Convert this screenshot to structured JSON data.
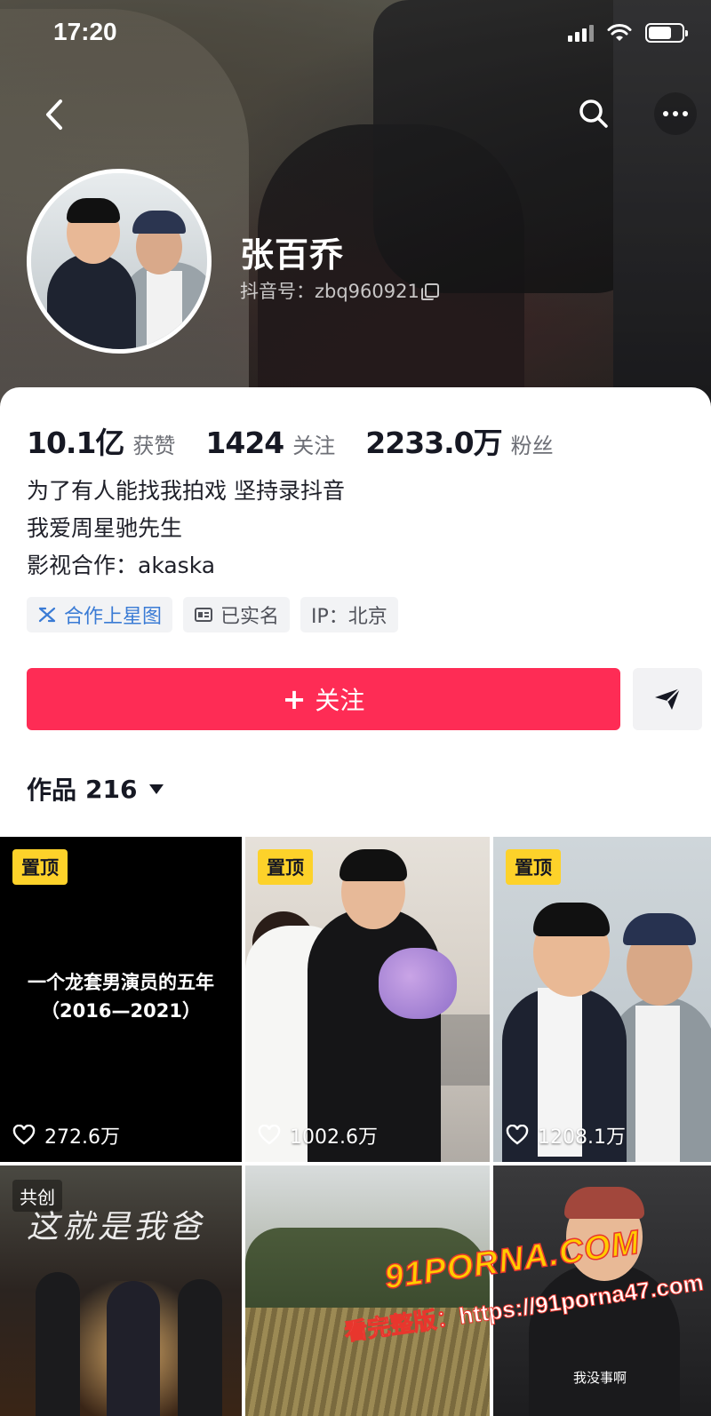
{
  "status_bar": {
    "time": "17:20"
  },
  "profile": {
    "name": "张百乔",
    "douyin_id": "抖音号：zbq960921"
  },
  "stats": [
    {
      "value": "10.1亿",
      "label": "获赞"
    },
    {
      "value": "1424",
      "label": "关注"
    },
    {
      "value": "2233.0万",
      "label": "粉丝"
    }
  ],
  "bio": [
    "为了有人能找我拍戏  坚持录抖音",
    "我爱周星驰先生",
    "影视合作：akaska"
  ],
  "tags": [
    {
      "label": "合作上星图",
      "icon": "star-map-icon",
      "color": "#3a7bd5"
    },
    {
      "label": "已实名",
      "icon": "id-card-icon"
    },
    {
      "label": "IP：北京"
    }
  ],
  "actions": {
    "follow_plus": "+",
    "follow_label": "关注",
    "accent_color": "#fe2c55"
  },
  "works": {
    "label": "作品",
    "count": "216"
  },
  "videos": [
    {
      "badge": "置顶",
      "likes": "272.6万",
      "cover_text": [
        "一个龙套男演员的五年",
        "（2016—2021）"
      ]
    },
    {
      "badge": "置顶",
      "likes": "1002.6万"
    },
    {
      "badge": "置顶",
      "likes": "1208.1万"
    },
    {
      "badge": "共创",
      "cover_title": "这就是我爸"
    },
    {},
    {
      "caption": "我没事啊"
    }
  ],
  "watermark": {
    "logo": "91PORNA.COM",
    "url": "看完整版：https://91porna47.com"
  }
}
